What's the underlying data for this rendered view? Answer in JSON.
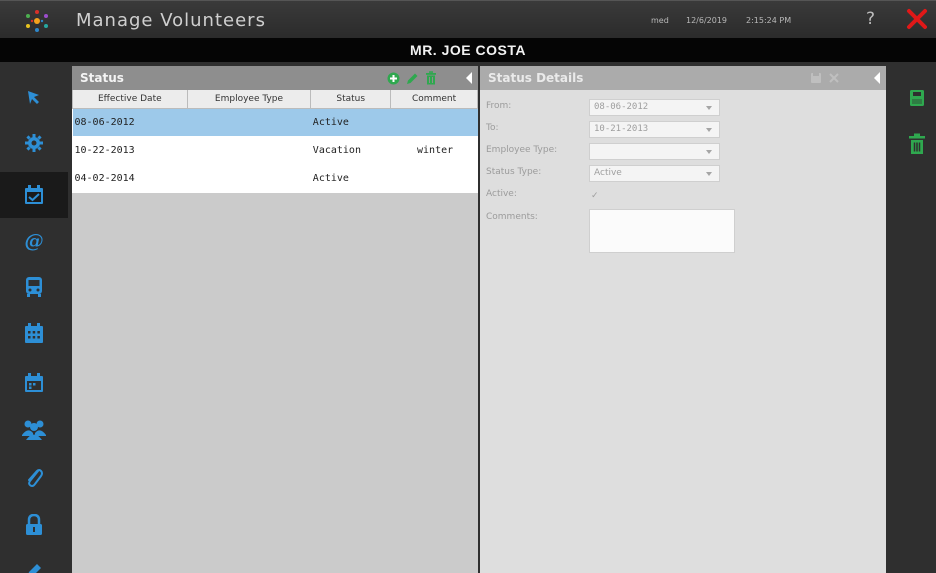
{
  "app": {
    "title": "Manage Volunteers",
    "user": "med",
    "date": "12/6/2019",
    "time": "2:15:24 PM",
    "help_label": "?"
  },
  "person": {
    "name": "MR. JOE COSTA"
  },
  "sidebar": {
    "items": [
      {
        "icon": "pointer-icon"
      },
      {
        "icon": "gear-icon"
      },
      {
        "icon": "calendar-check-icon",
        "active": true
      },
      {
        "icon": "at-sign-icon"
      },
      {
        "icon": "bus-icon"
      },
      {
        "icon": "calendar-grid-icon"
      },
      {
        "icon": "calendar-days-icon"
      },
      {
        "icon": "people-group-icon"
      },
      {
        "icon": "paperclip-icon"
      },
      {
        "icon": "lock-icon"
      },
      {
        "icon": "pen-icon"
      }
    ]
  },
  "status_panel": {
    "title": "Status",
    "columns": [
      "Effective Date",
      "Employee Type",
      "Status",
      "Comment"
    ],
    "rows": [
      {
        "effective_date": "08-06-2012",
        "employee_type": "",
        "status": "Active",
        "comment": ""
      },
      {
        "effective_date": "10-22-2013",
        "employee_type": "",
        "status": "Vacation",
        "comment": "winter"
      },
      {
        "effective_date": "04-02-2014",
        "employee_type": "",
        "status": "Active",
        "comment": ""
      }
    ]
  },
  "details_panel": {
    "title": "Status Details",
    "labels": {
      "from": "From:",
      "to": "To:",
      "employee_type": "Employee Type:",
      "status_type": "Status Type:",
      "active": "Active:",
      "comments": "Comments:"
    },
    "values": {
      "from": "08-06-2012",
      "to": "10-21-2013",
      "employee_type": "",
      "status_type": "Active",
      "active_check": "✓",
      "comments": ""
    }
  },
  "colors": {
    "accent_green": "#2fa84f",
    "sidebar_icon_blue": "#2d8fd6",
    "close_red": "#e01818",
    "selected_row": "#9dc9ea"
  }
}
